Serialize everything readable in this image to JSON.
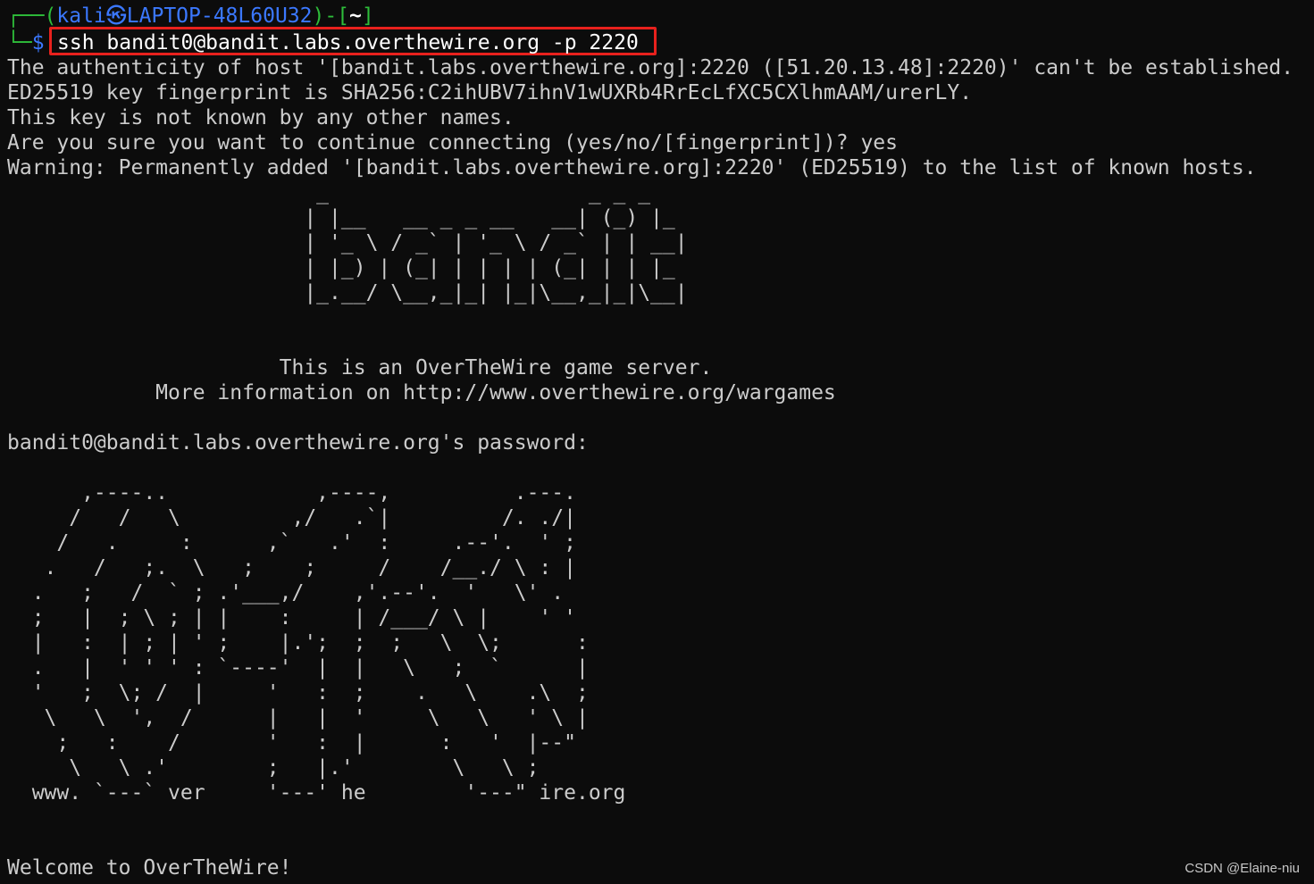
{
  "prompt": {
    "open": "┌──(",
    "user_host": "kali㉿LAPTOP-48L60U32",
    "mid": ")-[",
    "dir": "~",
    "close": "]",
    "corner": "└─",
    "symbol": "$",
    "command": "ssh bandit0@bandit.labs.overthewire.org -p 2220",
    "highlight_color": "#e8211d"
  },
  "output_lines": [
    "The authenticity of host '[bandit.labs.overthewire.org]:2220 ([51.20.13.48]:2220)' can't be established.",
    "ED25519 key fingerprint is SHA256:C2ihUBV7ihnV1wUXRb4RrEcLfXC5CXlhmAAM/urerLY.",
    "This key is not known by any other names.",
    "Are you sure you want to continue connecting (yes/no/[fingerprint])? yes",
    "Warning: Permanently added '[bandit.labs.overthewire.org]:2220' (ED25519) to the list of known hosts."
  ],
  "banner_art": "                         _                     _ _ _\n                        | |__   __ _ _ __   __| (_) |_\n                        | '_ \\ / _` | '_ \\ / _` | | __|\n                        | |_) | (_| | | | | (_| | | |_\n                        |_.__/ \\__,_|_| |_|\\__,_|_|\\__|",
  "info_lines": "                      This is an OverTheWire game server.\n            More information on http://www.overthewire.org/wargames",
  "password_prompt": "bandit0@bandit.labs.overthewire.org's password:",
  "logo_art": "      ,----..            ,----,          .---.\n     /   /   \\         ,/   .`|         /. ./|\n    /   .     :      ,`   .'  :     .--'.  ' ;\n   .   /   ;.  \\   ;    ;     /    /__./ \\ : |\n  .   ;   /  ` ; .'___,/    ,'.--'.  '   \\' .\n  ;   |  ; \\ ; | |    :     | /___/ \\ |    ' '\n  |   :  | ; | ' ;    |.';  ;  ;   \\  \\;      :\n  .   |  ' ' ' : `----'  |  |   \\   ;  `      |\n  '   ;  \\; /  |     '   :  ;    .   \\    .\\  ;\n   \\   \\  ',  /      |   |  '     \\   \\   ' \\ |\n    ;   :    /       '   :  |      :   '  |--\"\n     \\   \\ .'        ;   |.'        \\   \\ ;\n  www. `---` ver     '---' he        '---\" ire.org",
  "welcome": "Welcome to OverTheWire!",
  "watermark": "CSDN @Elaine-niu"
}
